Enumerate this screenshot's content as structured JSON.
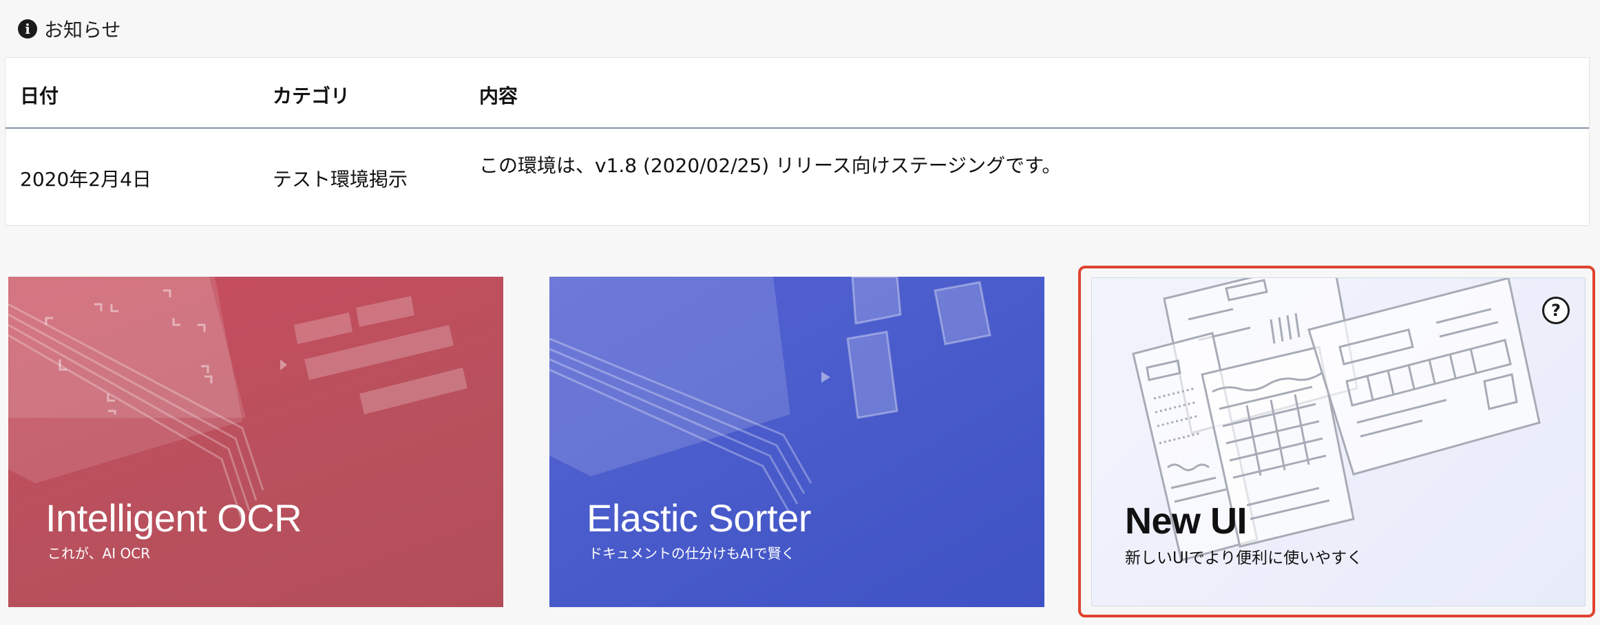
{
  "notice": {
    "heading": "お知らせ",
    "icon": "info-icon",
    "columns": {
      "date": "日付",
      "category": "カテゴリ",
      "content": "内容"
    },
    "rows": [
      {
        "date": "2020年2月4日",
        "category": "テスト環境掲示",
        "content": "この環境は、v1.8 (2020/02/25) リリース向けステージングです。"
      }
    ]
  },
  "cards": {
    "ocr": {
      "title": "Intelligent OCR",
      "subtitle": "これが、AI OCR",
      "color": "#c04f5d"
    },
    "sorter": {
      "title": "Elastic Sorter",
      "subtitle": "ドキュメントの仕分けもAIで賢く",
      "color": "#4a5ccb"
    },
    "newui": {
      "title": "New UI",
      "subtitle": "新しいUIでより便利に使いやすく",
      "help_icon": "question-circle-icon",
      "highlight_color": "#e0432f",
      "help_label": "?"
    }
  }
}
